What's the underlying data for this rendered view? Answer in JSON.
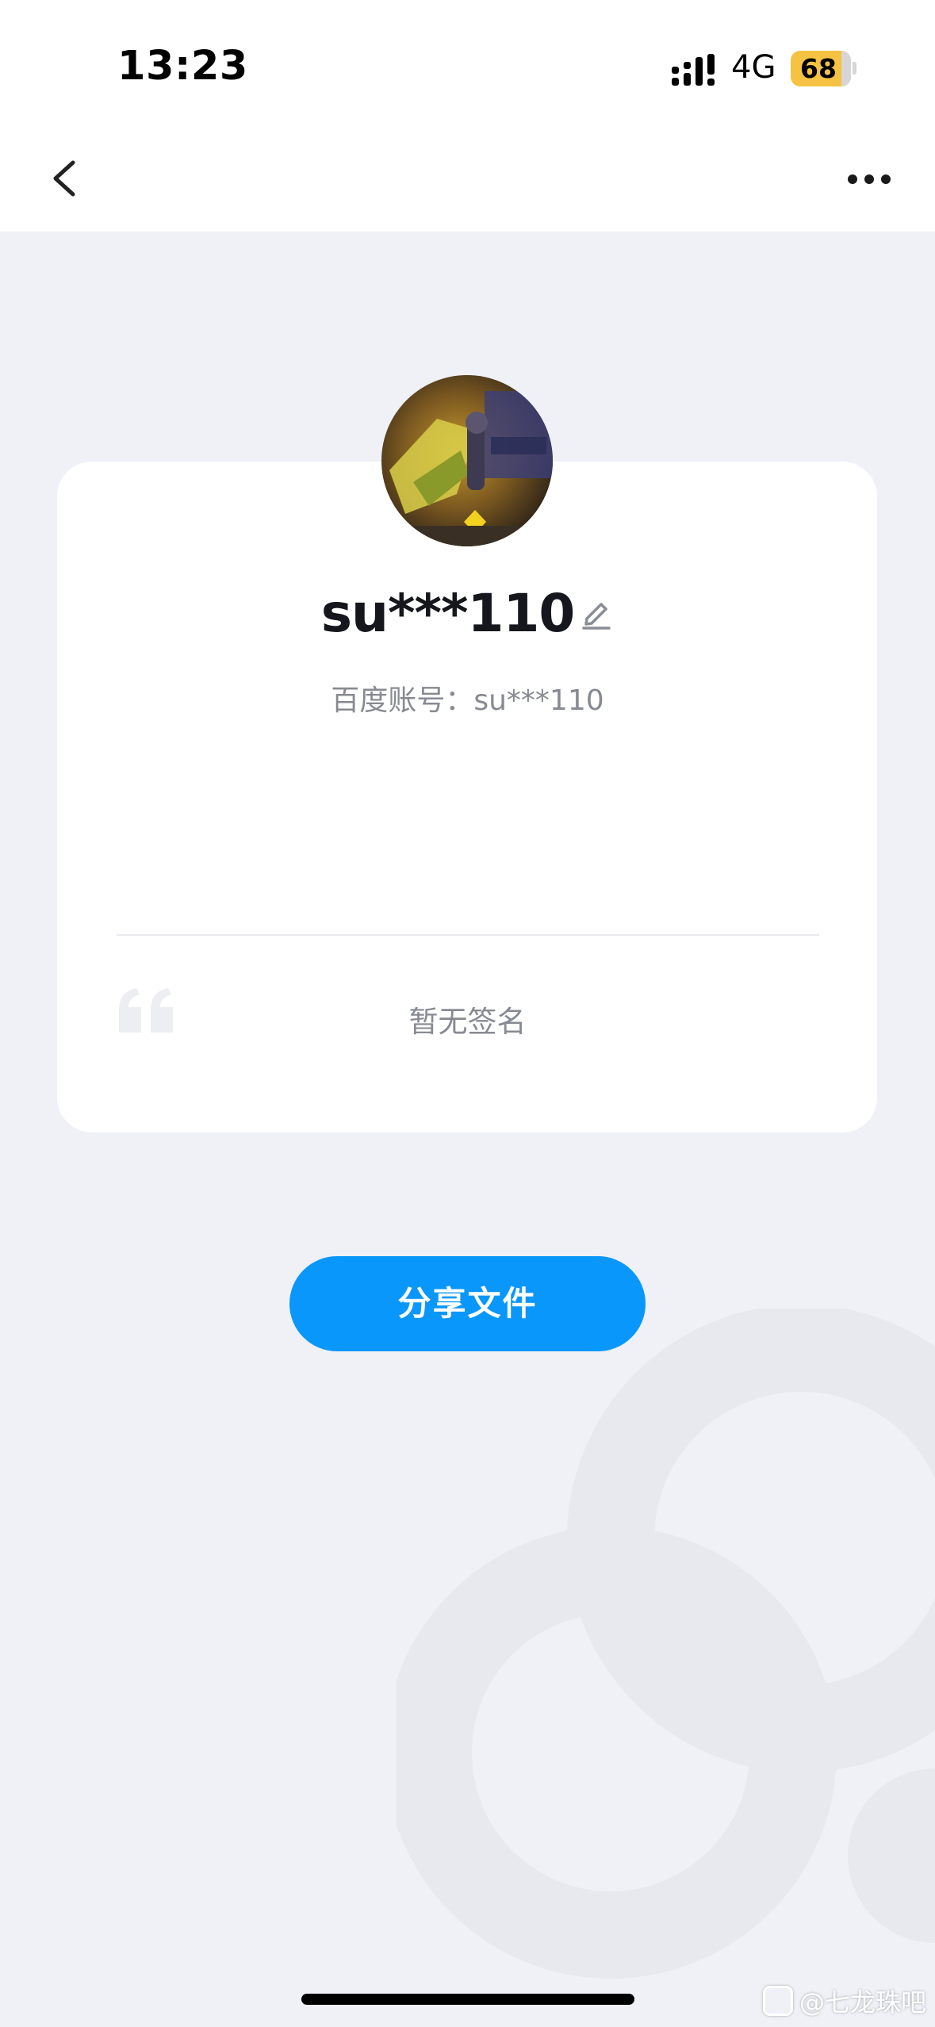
{
  "status_bar": {
    "time": "13:23",
    "network": "4G",
    "battery": "68",
    "battery_color": "#f5c242"
  },
  "nav": {
    "back_icon": "chevron-left-icon",
    "more_icon": "ellipsis-horizontal-icon"
  },
  "profile": {
    "username": "su***110",
    "account_label": "百度账号：su***110",
    "signature": "暂无签名",
    "edit_icon": "pencil-icon",
    "quote_icon": "quote-icon"
  },
  "actions": {
    "share_label": "分享文件",
    "share_color": "#0a97fb"
  },
  "watermark": {
    "text": "@七龙珠吧"
  }
}
